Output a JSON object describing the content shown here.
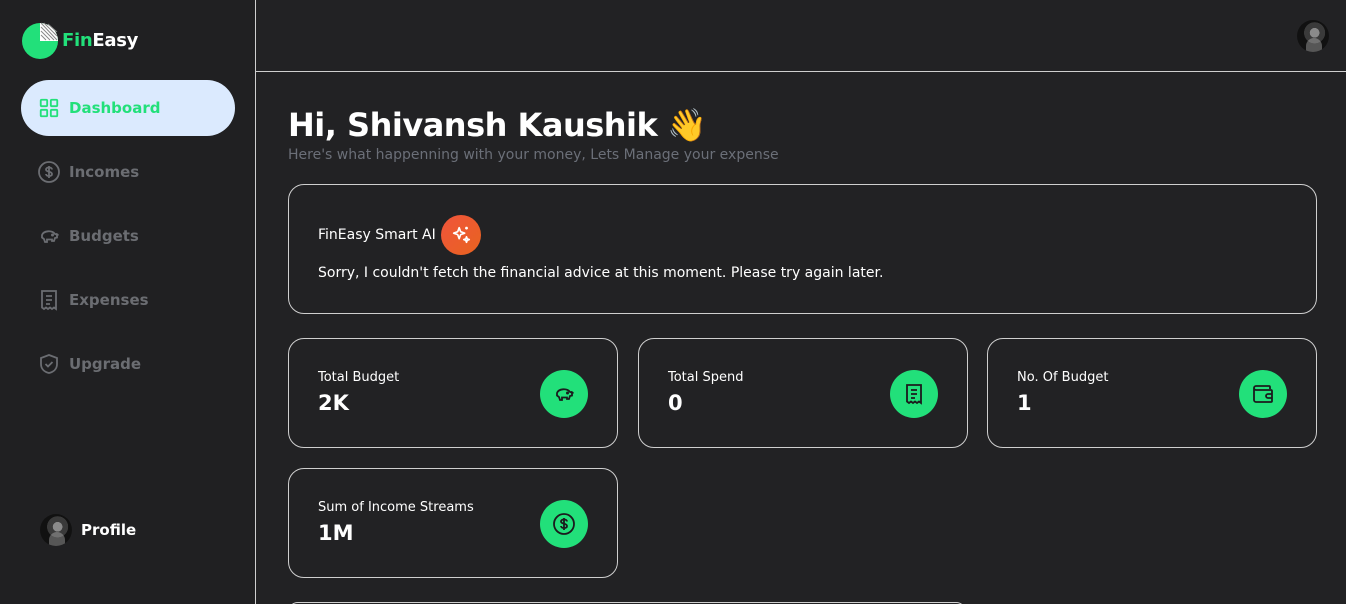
{
  "app": {
    "brand_prefix": "Fin",
    "brand_suffix": "Easy"
  },
  "sidebar": {
    "items": [
      {
        "label": "Dashboard",
        "icon": "grid-icon",
        "active": true
      },
      {
        "label": "Incomes",
        "icon": "dollar-circle-icon",
        "active": false
      },
      {
        "label": "Budgets",
        "icon": "piggy-bank-icon",
        "active": false
      },
      {
        "label": "Expenses",
        "icon": "receipt-icon",
        "active": false
      },
      {
        "label": "Upgrade",
        "icon": "shield-check-icon",
        "active": false
      }
    ],
    "profile_label": "Profile"
  },
  "main": {
    "greeting": "Hi, Shivansh Kaushik",
    "wave_emoji": "👋",
    "subtitle": "Here's what happenning with your money, Lets Manage your expense",
    "ai_card": {
      "title": "FinEasy Smart AI",
      "icon": "sparkles-icon",
      "message": "Sorry, I couldn't fetch the financial advice at this moment. Please try again later."
    },
    "stats": [
      {
        "label": "Total Budget",
        "value": "2K",
        "icon": "piggy-bank-icon"
      },
      {
        "label": "Total Spend",
        "value": "0",
        "icon": "receipt-icon"
      },
      {
        "label": "No. Of Budget",
        "value": "1",
        "icon": "wallet-icon"
      },
      {
        "label": "Sum of Income Streams",
        "value": "1M",
        "icon": "dollar-circle-icon"
      }
    ]
  },
  "colors": {
    "accent": "#22e07a",
    "active_bg": "#dbeafe",
    "muted": "#6b6d72",
    "ai_badge": "#f0543c",
    "background": "#222224"
  }
}
